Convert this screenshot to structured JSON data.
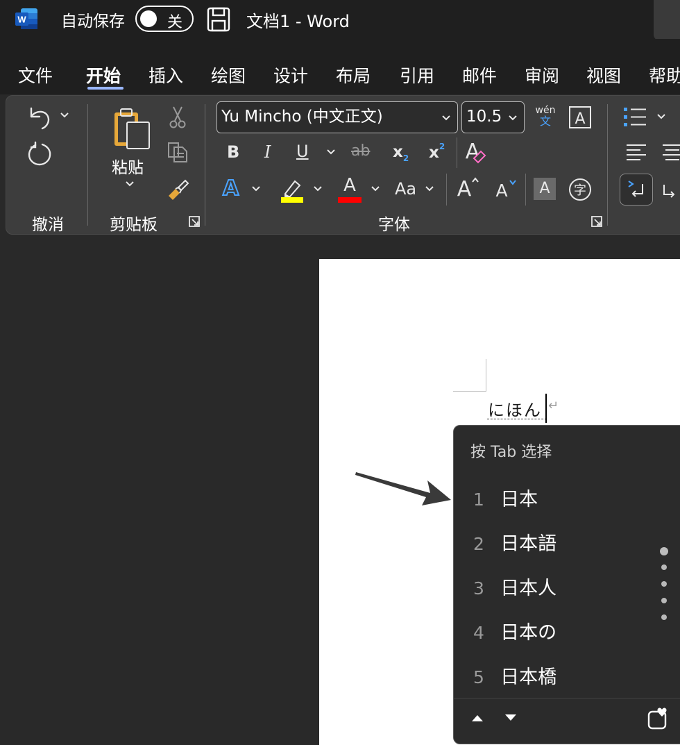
{
  "titlebar": {
    "autosave_label": "自动保存",
    "autosave_state": "关",
    "doc_title": "文档1  -  Word"
  },
  "tabs": [
    {
      "label": "文件"
    },
    {
      "label": "开始",
      "active": true
    },
    {
      "label": "插入"
    },
    {
      "label": "绘图"
    },
    {
      "label": "设计"
    },
    {
      "label": "布局"
    },
    {
      "label": "引用"
    },
    {
      "label": "邮件"
    },
    {
      "label": "审阅"
    },
    {
      "label": "视图"
    },
    {
      "label": "帮助"
    }
  ],
  "ribbon": {
    "undo_group_label": "撤消",
    "clipboard_group_label": "剪贴板",
    "paste_label": "粘贴",
    "font_group_label": "字体",
    "font_name": "Yu Mincho (中文正文)",
    "font_size": "10.5",
    "phonetic_top": "wén",
    "phonetic_bottom": "文",
    "buttons": {
      "bold": "B",
      "italic": "I",
      "underline": "U",
      "strike": "ab",
      "subscript": "x",
      "subscript_mark": "2",
      "superscript": "x",
      "superscript_mark": "2",
      "text_effects": "A",
      "font_color": "A",
      "change_case": "Aa",
      "grow_font": "A",
      "shrink_font": "A",
      "char_shading": "A",
      "enclose_char": "字",
      "char_border": "A"
    },
    "colors": {
      "highlight": "#ffff00",
      "font_color": "#ff0000",
      "accent": "#4aa3ff"
    }
  },
  "document": {
    "text": "にほん",
    "return_mark": "↵"
  },
  "ime": {
    "hint": "按 Tab 选择",
    "candidates": [
      {
        "num": "1",
        "text": "日本"
      },
      {
        "num": "2",
        "text": "日本語"
      },
      {
        "num": "3",
        "text": "日本人"
      },
      {
        "num": "4",
        "text": "日本の"
      },
      {
        "num": "5",
        "text": "日本橋"
      }
    ]
  }
}
